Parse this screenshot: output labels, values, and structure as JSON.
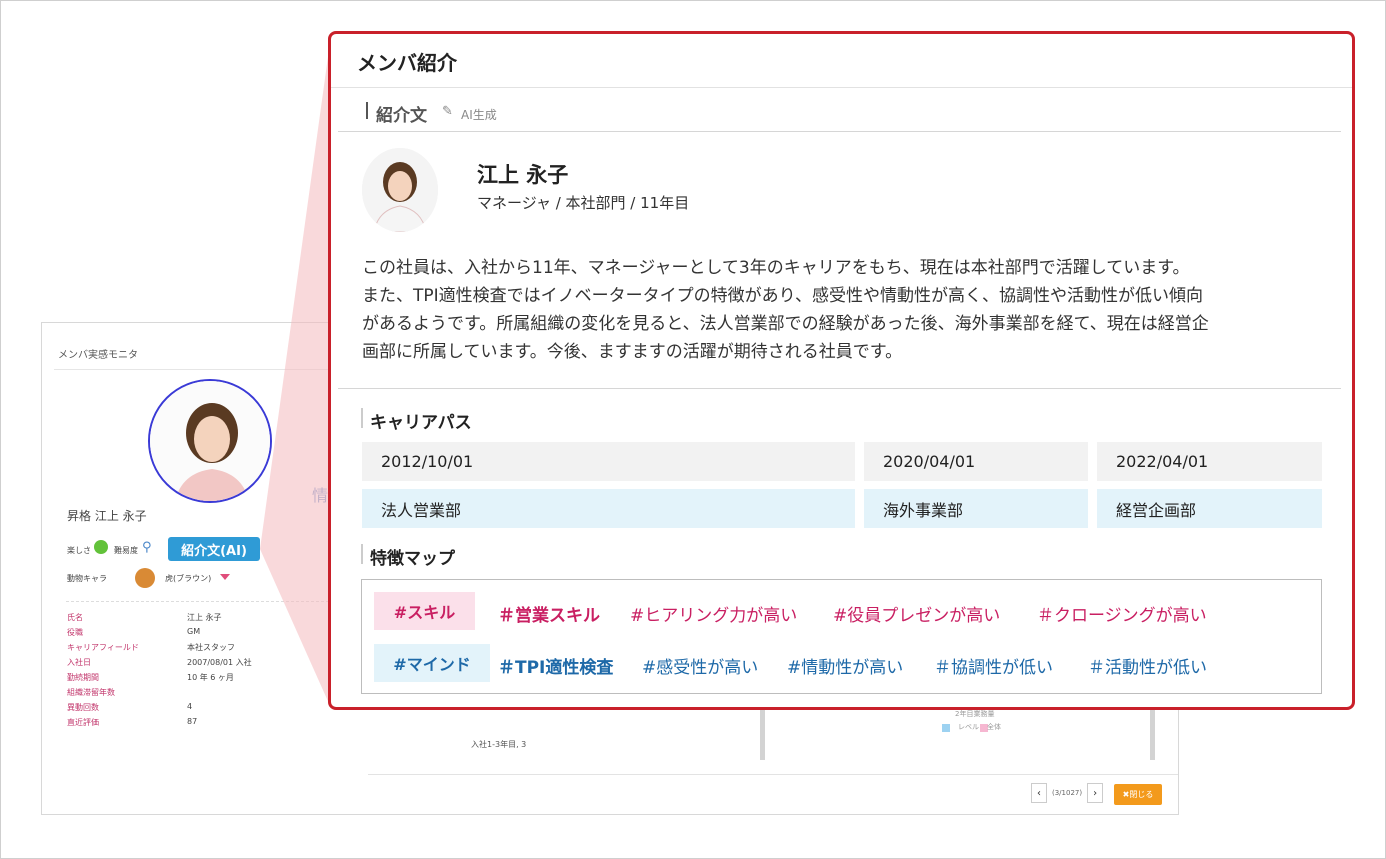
{
  "background_panel": {
    "title": "メンバ実感モニタ",
    "name_line": "昇格 江上 永子",
    "row1_label_a": "楽しさ",
    "row1_label_b": "難易度",
    "intro_button": "紹介文(AI)",
    "animal_label": "動物キャラ",
    "animal_value": "虎(ブラウン)",
    "partial_text": "情",
    "fields": [
      {
        "key": "氏名",
        "value": "江上 永子"
      },
      {
        "key": "役職",
        "value": "GM"
      },
      {
        "key": "キャリアフィールド",
        "value": "本社スタッフ"
      },
      {
        "key": "入社日",
        "value": "2007/08/01 入社"
      },
      {
        "key": "勤続期間",
        "value": "10 年 6 ヶ月"
      },
      {
        "key": "組織滞留年数",
        "value": ""
      },
      {
        "key": "異動回数",
        "value": "4"
      },
      {
        "key": "直近評価",
        "value": "87"
      }
    ],
    "chart_label": "入社1-3年目, 3",
    "legend_title": "2年目業務量",
    "legend_a": "レベル",
    "legend_b": "全体",
    "pager": {
      "prev": "‹",
      "count": "(3/1027)",
      "next": "›"
    },
    "close_button": "✖閉じる"
  },
  "modal": {
    "title": "メンバ紹介",
    "intro_section_title": "紹介文",
    "ai_label": "AI生成",
    "profile": {
      "name": "江上 永子",
      "role": "マネージャ / 本社部門 / 11年目"
    },
    "intro_lines": [
      "この社員は、入社から11年、マネージャーとして3年のキャリアをもち、現在は本社部門で活躍しています。",
      "また、TPI適性検査ではイノベータータイプの特徴があり、感受性や情動性が高く、協調性や活動性が低い傾向",
      "があるようです。所属組織の変化を見ると、法人営業部での経験があった後、海外事業部を経て、現在は経営企",
      "画部に所属しています。今後、ますますの活躍が期待される社員です。"
    ],
    "career_title": "キャリアパス",
    "career": [
      {
        "date": "2012/10/01",
        "dept": "法人営業部"
      },
      {
        "date": "2020/04/01",
        "dept": "海外事業部"
      },
      {
        "date": "2022/04/01",
        "dept": "経営企画部"
      }
    ],
    "feature_title": "特徴マップ",
    "skill_category": "#スキル",
    "skill_tags": [
      "＃営業スキル",
      "#ヒアリング力が高い",
      "#役員プレゼンが高い",
      "＃クロージングが高い"
    ],
    "mind_category": "#マインド",
    "mind_tags": [
      "＃TPI適性検査",
      "#感受性が高い",
      "#情動性が高い",
      "＃協調性が低い",
      "＃活動性が低い"
    ]
  },
  "colors": {
    "modal_border": "#c9202a",
    "skill_tag": "#c91f62",
    "mind_tag": "#1e69a8",
    "intro_button": "#2f9bd6",
    "close_button": "#f39a1c"
  }
}
